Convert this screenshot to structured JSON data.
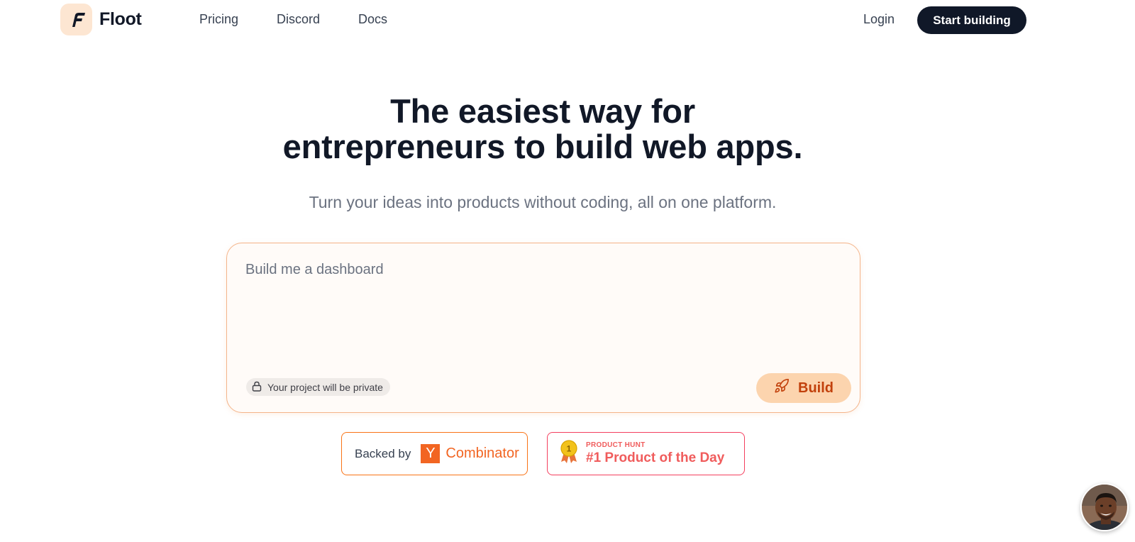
{
  "nav": {
    "brand": "Floot",
    "links": [
      "Pricing",
      "Discord",
      "Docs"
    ],
    "login": "Login",
    "cta": "Start building"
  },
  "hero": {
    "title_line1": "The easiest way for",
    "title_line2": "entrepreneurs to build web apps.",
    "subtitle": "Turn your ideas into products without coding, all on one platform."
  },
  "prompt": {
    "placeholder": "Build me a dashboard",
    "private_note": "Your project will be private",
    "build_label": "Build"
  },
  "badges": {
    "yc": {
      "prefix": "Backed by",
      "logo_letter": "Y",
      "name": "Combinator"
    },
    "producthunt": {
      "kicker": "PRODUCT HUNT",
      "title": "#1 Product of the Day",
      "medal": "1"
    }
  },
  "colors": {
    "dark": "#101828",
    "accent_orange": "#f97316",
    "build_bg": "#fcd4ae",
    "ph_red": "#f05c5c"
  }
}
